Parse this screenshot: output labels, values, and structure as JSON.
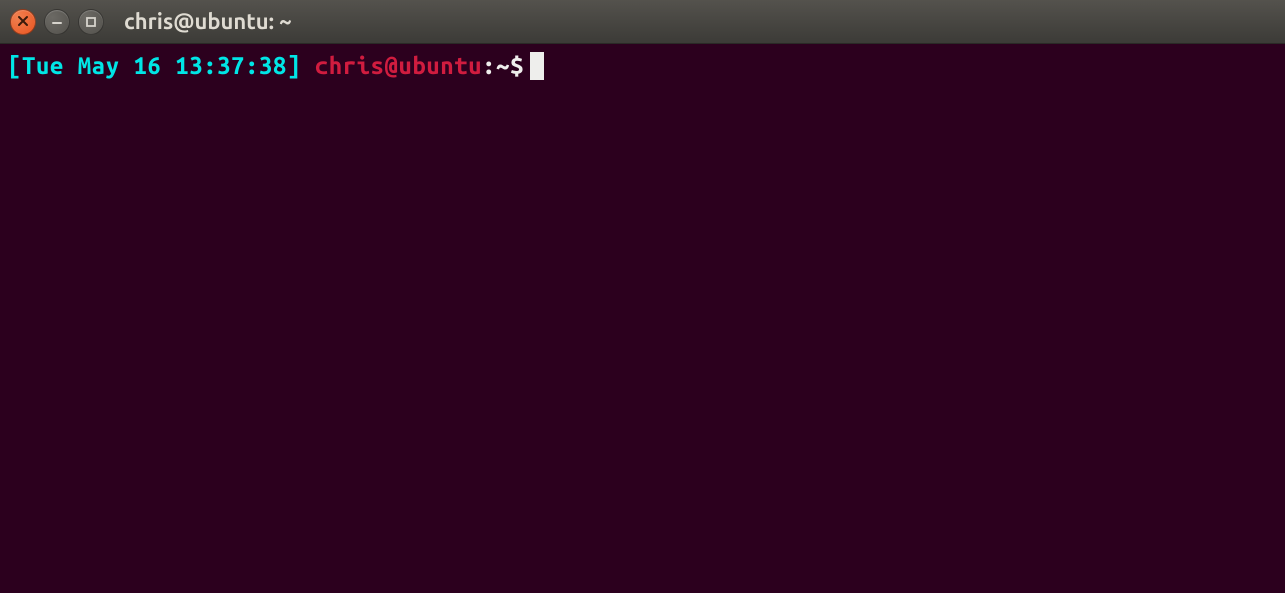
{
  "window": {
    "title": "chris@ubuntu: ~"
  },
  "prompt": {
    "timestamp_open": "[",
    "timestamp_value": "Tue May 16 13:37:38",
    "timestamp_close": "]",
    "user_host": "chris@ubuntu",
    "separator": ":",
    "path": "~",
    "symbol": "$"
  }
}
